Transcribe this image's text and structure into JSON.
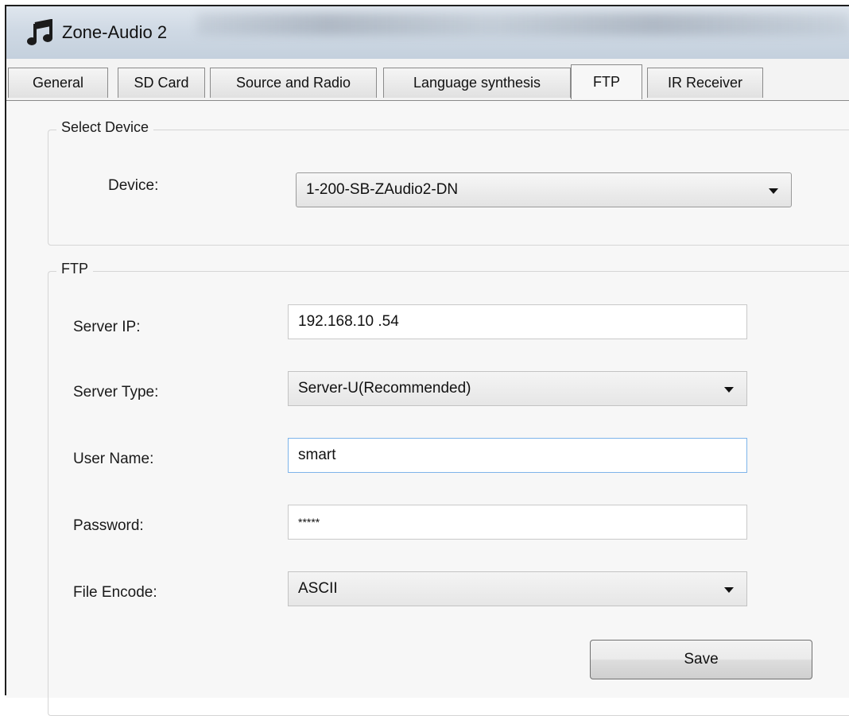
{
  "window": {
    "title": "Zone-Audio 2",
    "icon": "music-note-icon"
  },
  "tabs": [
    {
      "label": "General",
      "active": false
    },
    {
      "label": "SD Card",
      "active": false
    },
    {
      "label": "Source and Radio",
      "active": false
    },
    {
      "label": "Language synthesis",
      "active": false
    },
    {
      "label": "FTP",
      "active": true
    },
    {
      "label": "IR Receiver",
      "active": false
    }
  ],
  "select_device": {
    "legend": "Select Device",
    "device_label": "Device:",
    "device_value": "1-200-SB-ZAudio2-DN"
  },
  "ftp": {
    "legend": "FTP",
    "server_ip_label": "Server IP:",
    "server_ip_value": "192.168.10 .54",
    "server_type_label": "Server Type:",
    "server_type_value": "Server-U(Recommended)",
    "user_name_label": "User Name:",
    "user_name_value": "smart",
    "password_label": "Password:",
    "password_value": "*****",
    "file_encode_label": "File Encode:",
    "file_encode_value": "ASCII",
    "save_label": "Save"
  },
  "colors": {
    "accent_focus_border": "#7eb4ea",
    "background": "#f7f7f7"
  }
}
